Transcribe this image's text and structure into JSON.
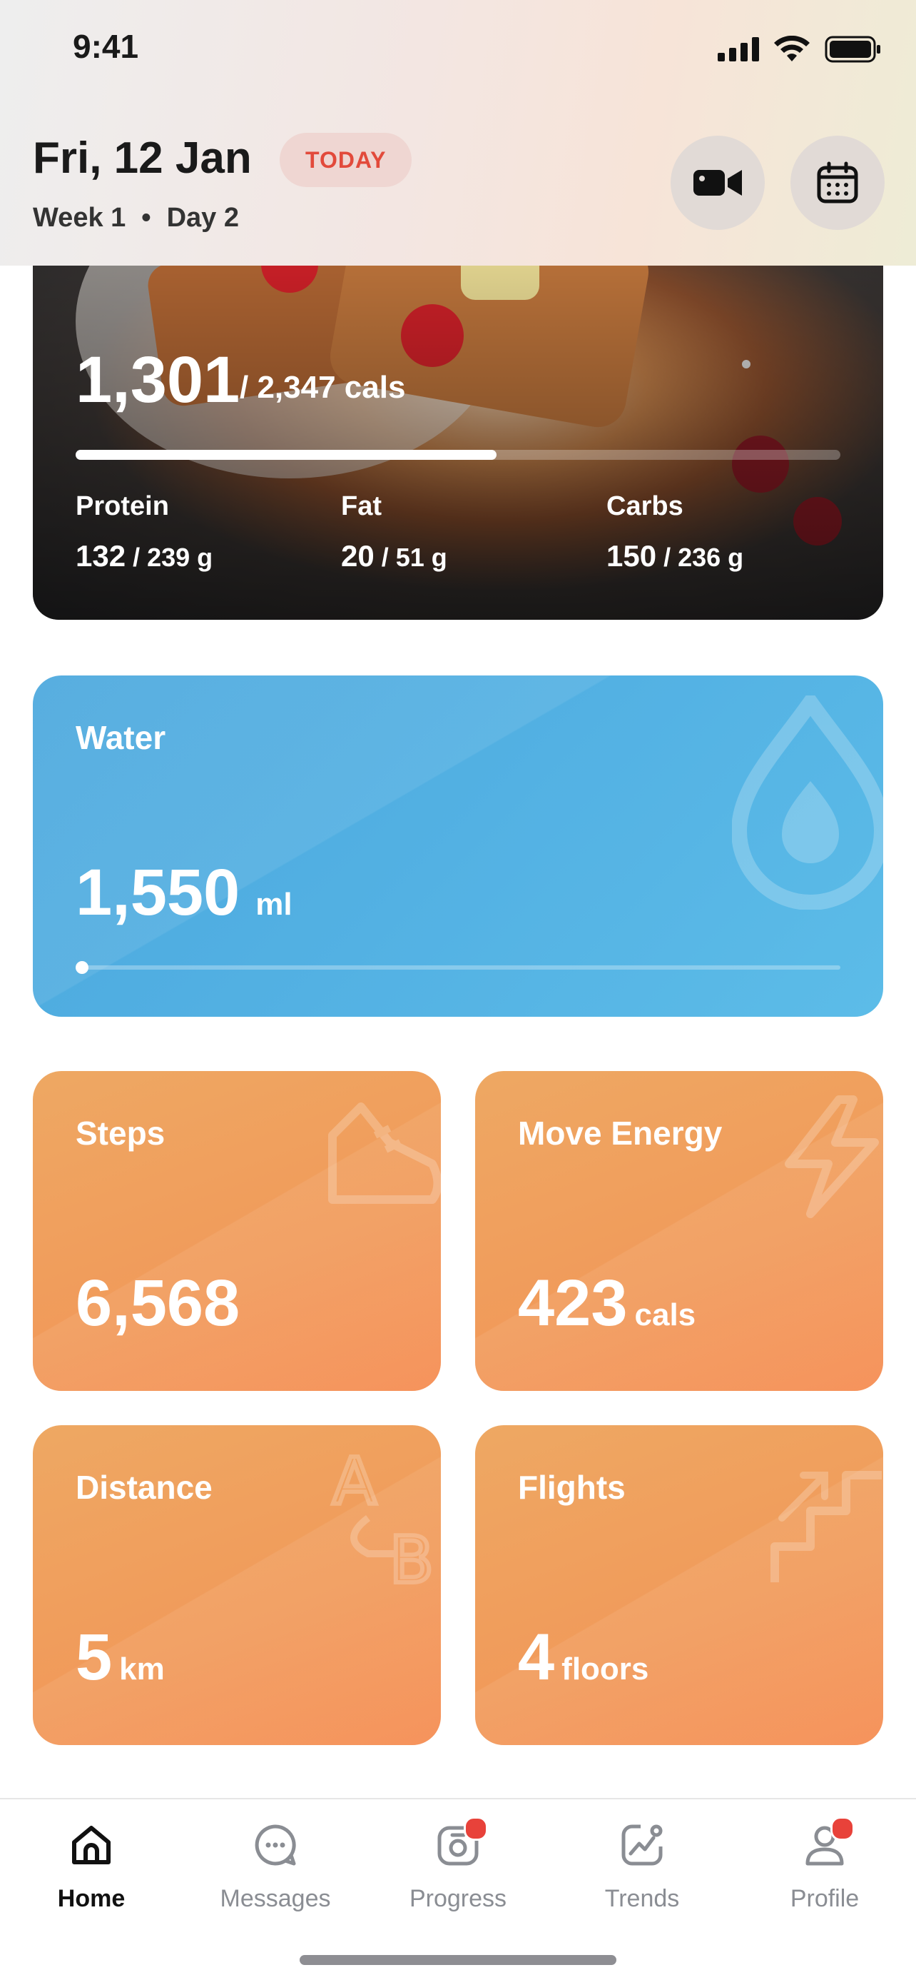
{
  "status_bar": {
    "time": "9:41"
  },
  "header": {
    "date": "Fri, 12 Jan",
    "badge": "TODAY",
    "week": "Week 1",
    "separator": "•",
    "day": "Day 2"
  },
  "calories": {
    "consumed": "1,301",
    "goal_text": "/ 2,347 cals",
    "progress": 0.55,
    "macros": [
      {
        "label": "Protein",
        "value": "132",
        "goal": "/ 239 g"
      },
      {
        "label": "Fat",
        "value": "20",
        "goal": "/ 51 g"
      },
      {
        "label": "Carbs",
        "value": "150",
        "goal": "/ 236 g"
      }
    ]
  },
  "water": {
    "title": "Water",
    "value": "1,550",
    "unit": "ml",
    "progress": 0.0
  },
  "stats": [
    {
      "title": "Steps",
      "value": "6,568",
      "unit": ""
    },
    {
      "title": "Move Energy",
      "value": "423",
      "unit": "cals"
    },
    {
      "title": "Distance",
      "value": "5",
      "unit": "km"
    },
    {
      "title": "Flights",
      "value": "4",
      "unit": "floors"
    }
  ],
  "tabs": [
    {
      "label": "Home",
      "icon": "home-icon",
      "active": true
    },
    {
      "label": "Messages",
      "icon": "chat-icon"
    },
    {
      "label": "Progress",
      "icon": "camera-icon",
      "notification": true
    },
    {
      "label": "Trends",
      "icon": "trend-icon"
    },
    {
      "label": "Profile",
      "icon": "profile-icon",
      "notification": true
    }
  ],
  "colors": {
    "accent_red": "#e24a3b",
    "water_blue": "#4fadE0",
    "stat_orange": "#f19a5a"
  }
}
